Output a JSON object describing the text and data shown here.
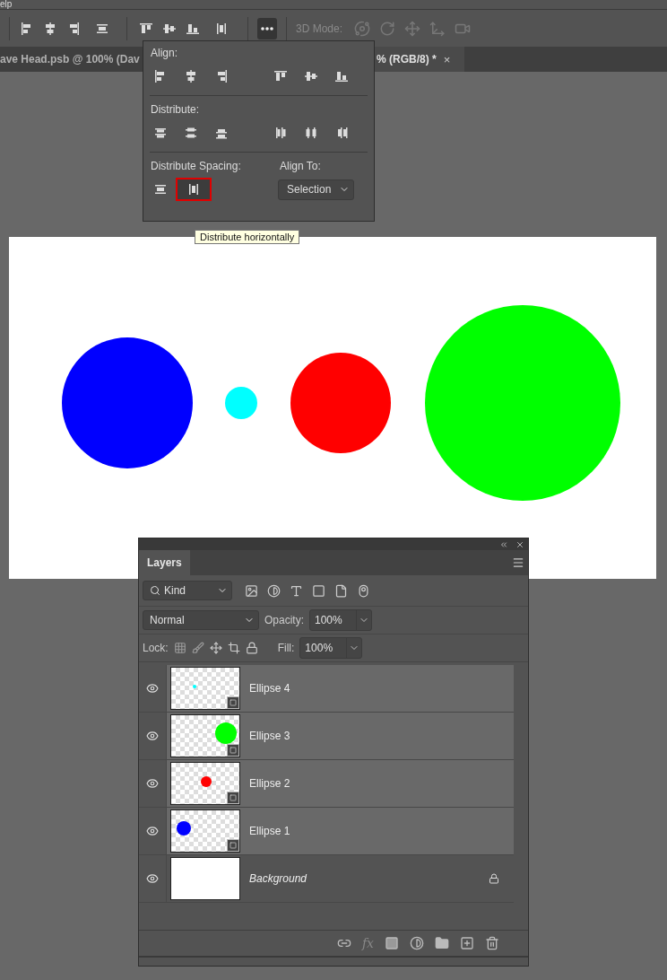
{
  "menu_bar": {
    "items": [
      "elp"
    ]
  },
  "options_bar": {
    "more_button": {
      "selected": true
    },
    "mode_label": "3D Mode:"
  },
  "document_tabs": [
    {
      "label": "ave Head.psb @ 100% (Dav",
      "selected": false
    },
    {
      "label": "% (RGB/8) *",
      "selected": true,
      "close": "×"
    }
  ],
  "align_popup": {
    "align_title": "Align:",
    "distribute_title": "Distribute:",
    "spacing_title": "Distribute Spacing:",
    "spacing_buttons": [
      {
        "kind": "vertical",
        "selected": false
      },
      {
        "kind": "horizontal",
        "selected": true
      }
    ],
    "align_to_label": "Align To:",
    "align_to_value": "Selection"
  },
  "tooltip": "Distribute horizontally",
  "layers_panel": {
    "tab": "Layers",
    "filter": "Kind",
    "blend_mode": "Normal",
    "opacity_label": "Opacity:",
    "opacity": "100%",
    "lock_label": "Lock:",
    "fill_label": "Fill:",
    "fill": "100%",
    "effects_label": "fx",
    "layers": [
      {
        "name": "Ellipse 4",
        "kind": "shape",
        "color": "#00ffff",
        "visible": true,
        "selected": true,
        "locked": false
      },
      {
        "name": "Ellipse 3",
        "kind": "shape",
        "color": "#00ff00",
        "visible": true,
        "selected": true,
        "locked": false
      },
      {
        "name": "Ellipse 2",
        "kind": "shape",
        "color": "#ff0000",
        "visible": true,
        "selected": true,
        "locked": false
      },
      {
        "name": "Ellipse 1",
        "kind": "shape",
        "color": "#0000ff",
        "visible": true,
        "selected": true,
        "locked": false
      },
      {
        "name": "Background",
        "kind": "background",
        "visible": true,
        "selected": false,
        "locked": true
      }
    ]
  }
}
